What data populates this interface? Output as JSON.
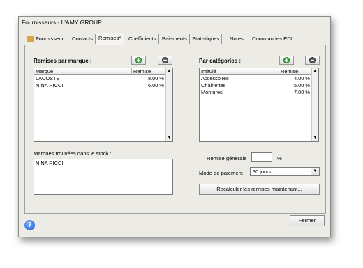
{
  "window": {
    "title": "Fournisseurs - L'AMY GROUP"
  },
  "tabs": [
    {
      "label": "Fournisseur"
    },
    {
      "label": "Contacts"
    },
    {
      "label": "Remises*"
    },
    {
      "label": "Coefficients"
    },
    {
      "label": "Paiements"
    },
    {
      "label": "Statistiques"
    },
    {
      "label": "Notes"
    },
    {
      "label": "Commandes EDI"
    }
  ],
  "active_tab": "Remises*",
  "brands": {
    "title": "Remises par marque :",
    "col_brand": "Marque",
    "col_discount": "Remise",
    "rows": [
      {
        "name": "LACOSTE",
        "discount": "8.00 %"
      },
      {
        "name": "NINA RICCI",
        "discount": "6.00 %"
      }
    ]
  },
  "categories": {
    "title": "Par catégories :",
    "col_name": "Intitulé",
    "col_discount": "Remise",
    "rows": [
      {
        "name": "Accessoires",
        "discount": "4.00 %"
      },
      {
        "name": "Chainettes",
        "discount": "5.00 %"
      },
      {
        "name": "Montures",
        "discount": "7.00 %"
      }
    ]
  },
  "stock_brands": {
    "label": "Marques trouvées dans le stock :",
    "items": [
      "NINA RICCI"
    ]
  },
  "general": {
    "remise_label": "Remise générale",
    "remise_value": "",
    "percent": "%",
    "payment_label": "Mode de paiement",
    "payment_value": "30 jours",
    "recalc_button": "Recalculer les remises maintenant..."
  },
  "footer": {
    "help": "?",
    "close_button": "Fermer"
  },
  "colors": {
    "add_green": "#3aa83a",
    "remove_gray": "#555555",
    "help_blue": "#1b56c8"
  }
}
